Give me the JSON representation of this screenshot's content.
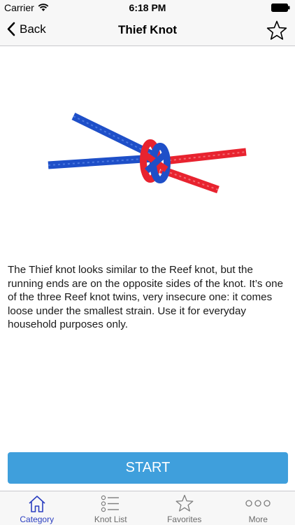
{
  "status": {
    "carrier": "Carrier",
    "time": "6:18 PM"
  },
  "nav": {
    "back_label": "Back",
    "title": "Thief Knot"
  },
  "content": {
    "description": "The Thief knot looks similar to the Reef knot, but the running ends are on the opposite sides of the knot. It’s one of the three Reef knot twins, very insecure one: it comes loose under the smallest strain. Use it for everyday household purposes only."
  },
  "actions": {
    "start_label": "START"
  },
  "tabs": [
    {
      "label": "Category",
      "icon": "house-icon",
      "active": true
    },
    {
      "label": "Knot List",
      "icon": "list-icon",
      "active": false
    },
    {
      "label": "Favorites",
      "icon": "star-icon",
      "active": false
    },
    {
      "label": "More",
      "icon": "more-icon",
      "active": false
    }
  ],
  "colors": {
    "accent": "#3f9fdc",
    "active_tab": "#2b3fc0",
    "rope_blue": "#1e4fc8",
    "rope_red": "#e8232f"
  }
}
